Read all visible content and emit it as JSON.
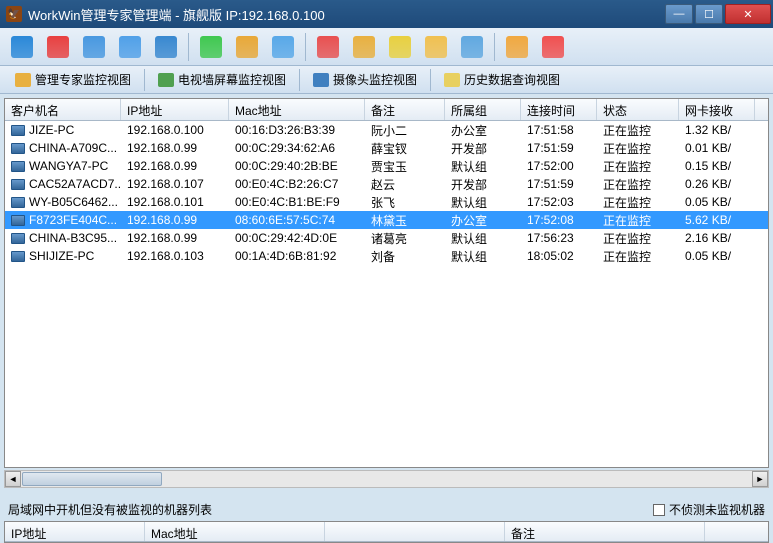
{
  "window": {
    "title": "WorkWin管理专家管理端 - 旗舰版 IP:192.168.0.100"
  },
  "toolbar_icons": [
    {
      "name": "monitor-icon",
      "color": "#2a88d8"
    },
    {
      "name": "capture-icon",
      "color": "#e84040"
    },
    {
      "name": "screen-icon",
      "color": "#4898e0"
    },
    {
      "name": "desktop-icon",
      "color": "#50a0e8"
    },
    {
      "name": "camera-icon",
      "color": "#3888d0"
    },
    {
      "name": "refresh-icon",
      "color": "#40c850"
    },
    {
      "name": "chart-icon",
      "color": "#e8a838"
    },
    {
      "name": "export-icon",
      "color": "#58a8e8"
    },
    {
      "name": "globe-icon",
      "color": "#e85050"
    },
    {
      "name": "disk-icon",
      "color": "#e8b040"
    },
    {
      "name": "network-icon",
      "color": "#e8d040"
    },
    {
      "name": "folder-icon",
      "color": "#f0c050"
    },
    {
      "name": "settings-icon",
      "color": "#60a8e0"
    },
    {
      "name": "user-icon",
      "color": "#f0a840"
    },
    {
      "name": "help-icon",
      "color": "#f05050"
    }
  ],
  "views": [
    {
      "name": "view-expert",
      "label": "管理专家监控视图",
      "color": "#e8b040"
    },
    {
      "name": "view-tvwall",
      "label": "电视墙屏幕监控视图",
      "color": "#50a050"
    },
    {
      "name": "view-camera",
      "label": "摄像头监控视图",
      "color": "#4080c0"
    },
    {
      "name": "view-history",
      "label": "历史数据查询视图",
      "color": "#e8d060"
    }
  ],
  "columns": [
    "客户机名",
    "IP地址",
    "Mac地址",
    "备注",
    "所属组",
    "连接时间",
    "状态",
    "网卡接收"
  ],
  "rows": [
    {
      "name": "JIZE-PC",
      "ip": "192.168.0.100",
      "mac": "00:16:D3:26:B3:39",
      "note": "阮小二",
      "group": "办公室",
      "time": "17:51:58",
      "status": "正在监控",
      "nic": "1.32 KB/"
    },
    {
      "name": "CHINA-A709C...",
      "ip": "192.168.0.99",
      "mac": "00:0C:29:34:62:A6",
      "note": "薛宝钗",
      "group": "开发部",
      "time": "17:51:59",
      "status": "正在监控",
      "nic": "0.01 KB/"
    },
    {
      "name": "WANGYA7-PC",
      "ip": "192.168.0.99",
      "mac": "00:0C:29:40:2B:BE",
      "note": "贾宝玉",
      "group": "默认组",
      "time": "17:52:00",
      "status": "正在监控",
      "nic": "0.15 KB/"
    },
    {
      "name": "CAC52A7ACD7...",
      "ip": "192.168.0.107",
      "mac": "00:E0:4C:B2:26:C7",
      "note": "赵云",
      "group": "开发部",
      "time": "17:51:59",
      "status": "正在监控",
      "nic": "0.26 KB/"
    },
    {
      "name": "WY-B05C6462...",
      "ip": "192.168.0.101",
      "mac": "00:E0:4C:B1:BE:F9",
      "note": "张飞",
      "group": "默认组",
      "time": "17:52:03",
      "status": "正在监控",
      "nic": "0.05 KB/"
    },
    {
      "name": "F8723FE404C...",
      "ip": "192.168.0.99",
      "mac": "08:60:6E:57:5C:74",
      "note": "林黛玉",
      "group": "办公室",
      "time": "17:52:08",
      "status": "正在监控",
      "nic": "5.62 KB/",
      "selected": true
    },
    {
      "name": "CHINA-B3C95...",
      "ip": "192.168.0.99",
      "mac": "00:0C:29:42:4D:0E",
      "note": "诸葛亮",
      "group": "默认组",
      "time": "17:56:23",
      "status": "正在监控",
      "nic": "2.16 KB/"
    },
    {
      "name": "SHIJIZE-PC",
      "ip": "192.168.0.103",
      "mac": "00:1A:4D:6B:81:92",
      "note": "刘备",
      "group": "默认组",
      "time": "18:05:02",
      "status": "正在监控",
      "nic": "0.05 KB/"
    }
  ],
  "bottom": {
    "label": "局域网中开机但没有被监视的机器列表",
    "check_label": "不侦测未监视机器",
    "columns": [
      "IP地址",
      "Mac地址",
      "",
      "备注"
    ]
  }
}
